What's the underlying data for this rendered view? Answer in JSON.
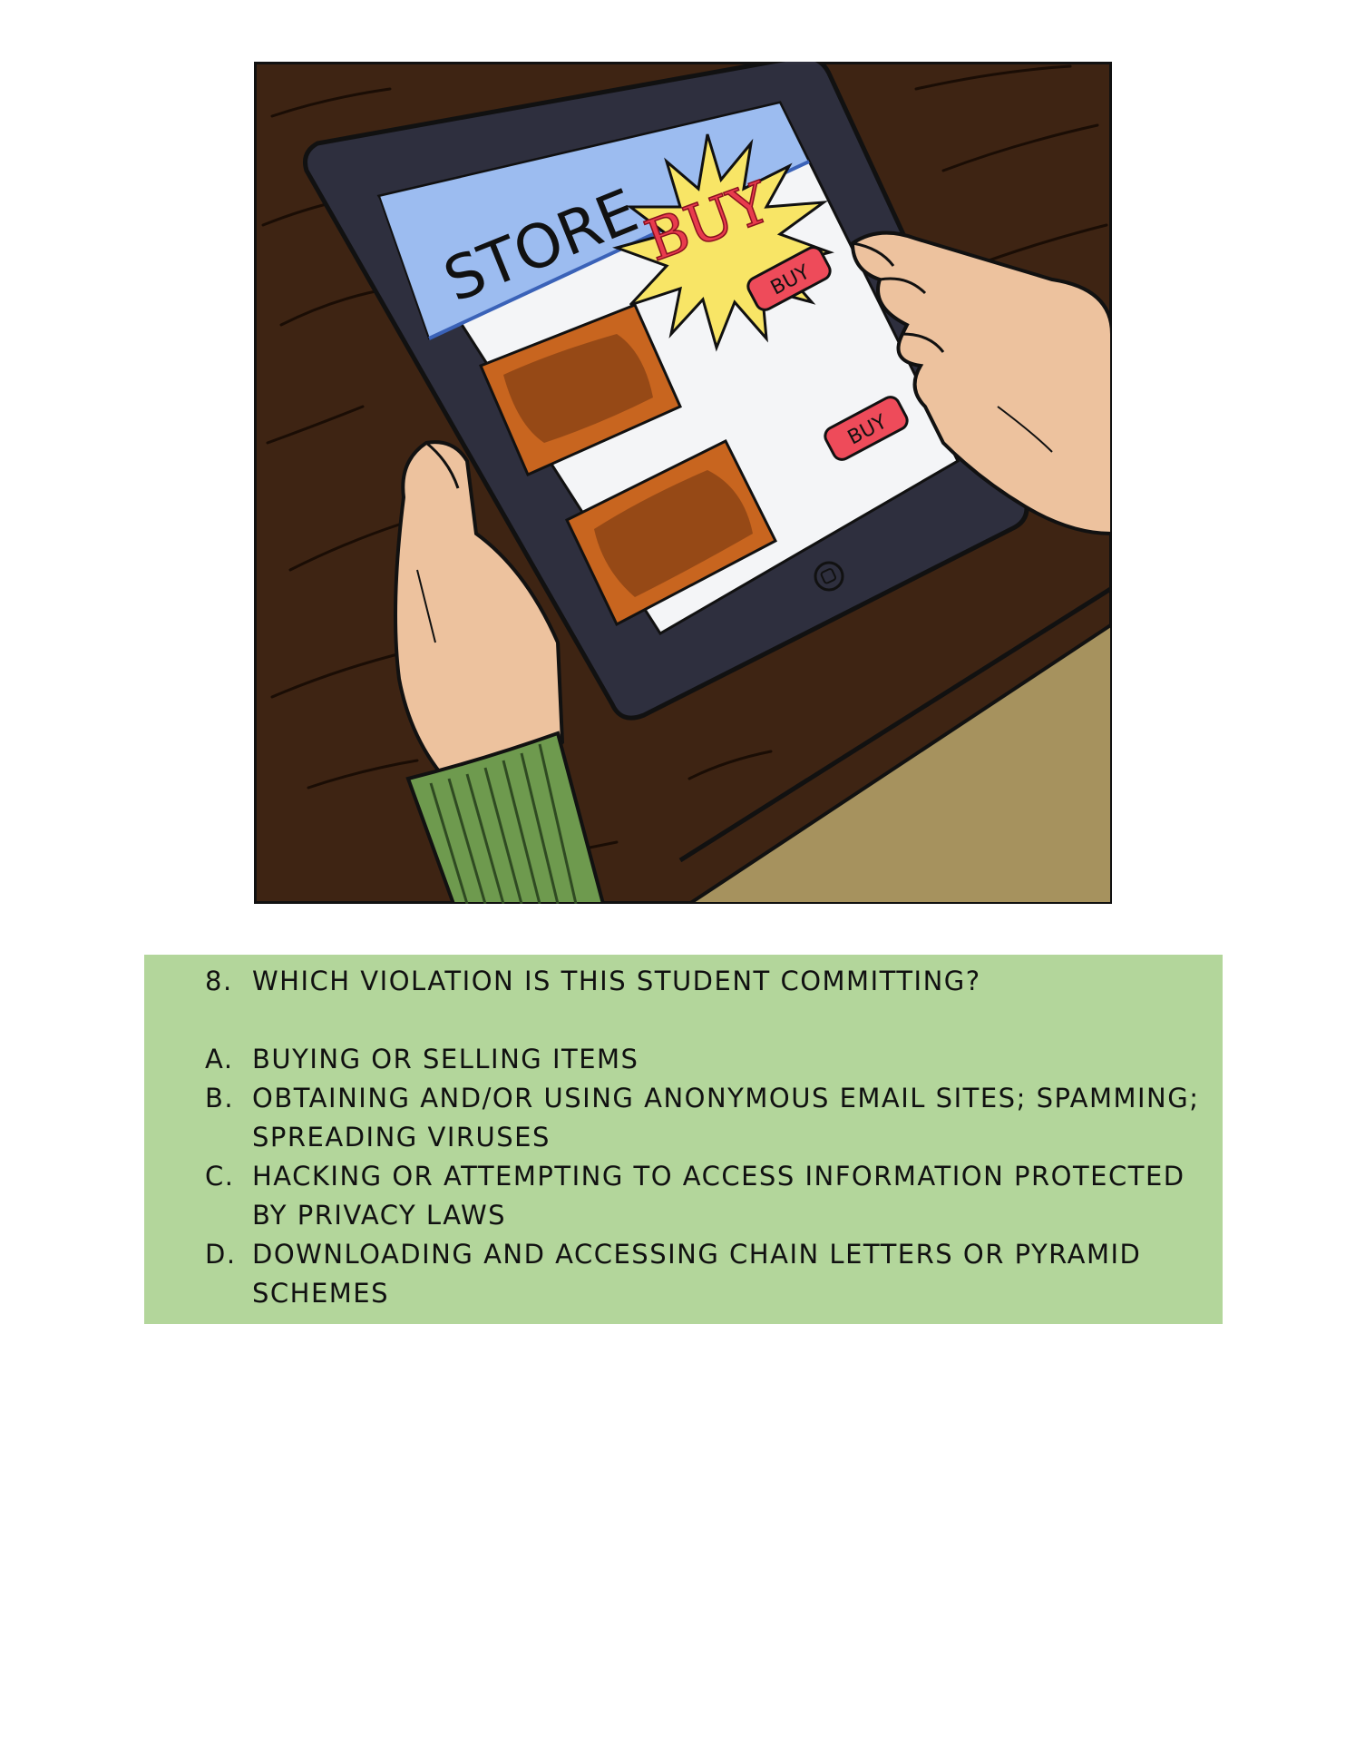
{
  "illustration": {
    "store_label": "STORE",
    "burst_label": "BUY",
    "button_label": "BUY"
  },
  "quiz": {
    "number": "8.",
    "question": "WHICH VIOLATION IS THIS STUDENT COMMITTING?",
    "options": [
      {
        "marker": "A.",
        "text": "BUYING OR SELLING ITEMS"
      },
      {
        "marker": "B.",
        "text": "OBTAINING AND/OR USING ANONYMOUS EMAIL SITES; SPAMMING; SPREADING VIRUSES"
      },
      {
        "marker": "C.",
        "text": "HACKING OR ATTEMPTING TO ACCESS INFORMATION PROTECTED BY PRIVACY LAWS"
      },
      {
        "marker": "D.",
        "text": "DOWNLOADING AND ACCESSING CHAIN LETTERS OR PYRAMID SCHEMES"
      }
    ]
  },
  "colors": {
    "panel_background": "#b3d69b",
    "desk_wood": "#3e2413",
    "tablet_frame": "#2e2f3e",
    "screen_header": "#9cbcf0",
    "burst": "#f8e566",
    "buy_button": "#ee4b5a",
    "product": "#c8651f",
    "skin": "#edc29e",
    "sleeve": "#6e9a4e",
    "floor": "#a6925e"
  }
}
